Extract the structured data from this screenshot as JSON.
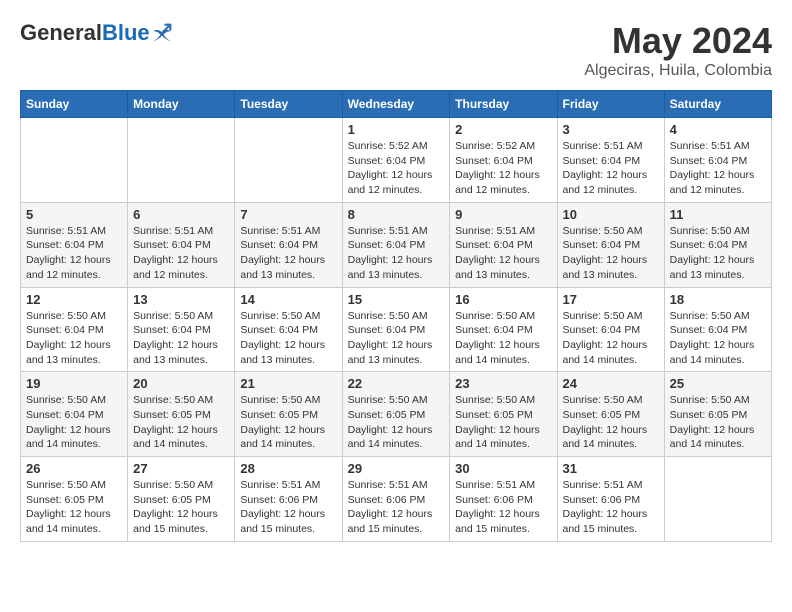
{
  "logo": {
    "general": "General",
    "blue": "Blue"
  },
  "title": {
    "month_year": "May 2024",
    "location": "Algeciras, Huila, Colombia"
  },
  "weekdays": [
    "Sunday",
    "Monday",
    "Tuesday",
    "Wednesday",
    "Thursday",
    "Friday",
    "Saturday"
  ],
  "weeks": [
    [
      {
        "day": "",
        "info": ""
      },
      {
        "day": "",
        "info": ""
      },
      {
        "day": "",
        "info": ""
      },
      {
        "day": "1",
        "info": "Sunrise: 5:52 AM\nSunset: 6:04 PM\nDaylight: 12 hours and 12 minutes."
      },
      {
        "day": "2",
        "info": "Sunrise: 5:52 AM\nSunset: 6:04 PM\nDaylight: 12 hours and 12 minutes."
      },
      {
        "day": "3",
        "info": "Sunrise: 5:51 AM\nSunset: 6:04 PM\nDaylight: 12 hours and 12 minutes."
      },
      {
        "day": "4",
        "info": "Sunrise: 5:51 AM\nSunset: 6:04 PM\nDaylight: 12 hours and 12 minutes."
      }
    ],
    [
      {
        "day": "5",
        "info": "Sunrise: 5:51 AM\nSunset: 6:04 PM\nDaylight: 12 hours and 12 minutes."
      },
      {
        "day": "6",
        "info": "Sunrise: 5:51 AM\nSunset: 6:04 PM\nDaylight: 12 hours and 12 minutes."
      },
      {
        "day": "7",
        "info": "Sunrise: 5:51 AM\nSunset: 6:04 PM\nDaylight: 12 hours and 13 minutes."
      },
      {
        "day": "8",
        "info": "Sunrise: 5:51 AM\nSunset: 6:04 PM\nDaylight: 12 hours and 13 minutes."
      },
      {
        "day": "9",
        "info": "Sunrise: 5:51 AM\nSunset: 6:04 PM\nDaylight: 12 hours and 13 minutes."
      },
      {
        "day": "10",
        "info": "Sunrise: 5:50 AM\nSunset: 6:04 PM\nDaylight: 12 hours and 13 minutes."
      },
      {
        "day": "11",
        "info": "Sunrise: 5:50 AM\nSunset: 6:04 PM\nDaylight: 12 hours and 13 minutes."
      }
    ],
    [
      {
        "day": "12",
        "info": "Sunrise: 5:50 AM\nSunset: 6:04 PM\nDaylight: 12 hours and 13 minutes."
      },
      {
        "day": "13",
        "info": "Sunrise: 5:50 AM\nSunset: 6:04 PM\nDaylight: 12 hours and 13 minutes."
      },
      {
        "day": "14",
        "info": "Sunrise: 5:50 AM\nSunset: 6:04 PM\nDaylight: 12 hours and 13 minutes."
      },
      {
        "day": "15",
        "info": "Sunrise: 5:50 AM\nSunset: 6:04 PM\nDaylight: 12 hours and 13 minutes."
      },
      {
        "day": "16",
        "info": "Sunrise: 5:50 AM\nSunset: 6:04 PM\nDaylight: 12 hours and 14 minutes."
      },
      {
        "day": "17",
        "info": "Sunrise: 5:50 AM\nSunset: 6:04 PM\nDaylight: 12 hours and 14 minutes."
      },
      {
        "day": "18",
        "info": "Sunrise: 5:50 AM\nSunset: 6:04 PM\nDaylight: 12 hours and 14 minutes."
      }
    ],
    [
      {
        "day": "19",
        "info": "Sunrise: 5:50 AM\nSunset: 6:04 PM\nDaylight: 12 hours and 14 minutes."
      },
      {
        "day": "20",
        "info": "Sunrise: 5:50 AM\nSunset: 6:05 PM\nDaylight: 12 hours and 14 minutes."
      },
      {
        "day": "21",
        "info": "Sunrise: 5:50 AM\nSunset: 6:05 PM\nDaylight: 12 hours and 14 minutes."
      },
      {
        "day": "22",
        "info": "Sunrise: 5:50 AM\nSunset: 6:05 PM\nDaylight: 12 hours and 14 minutes."
      },
      {
        "day": "23",
        "info": "Sunrise: 5:50 AM\nSunset: 6:05 PM\nDaylight: 12 hours and 14 minutes."
      },
      {
        "day": "24",
        "info": "Sunrise: 5:50 AM\nSunset: 6:05 PM\nDaylight: 12 hours and 14 minutes."
      },
      {
        "day": "25",
        "info": "Sunrise: 5:50 AM\nSunset: 6:05 PM\nDaylight: 12 hours and 14 minutes."
      }
    ],
    [
      {
        "day": "26",
        "info": "Sunrise: 5:50 AM\nSunset: 6:05 PM\nDaylight: 12 hours and 14 minutes."
      },
      {
        "day": "27",
        "info": "Sunrise: 5:50 AM\nSunset: 6:05 PM\nDaylight: 12 hours and 15 minutes."
      },
      {
        "day": "28",
        "info": "Sunrise: 5:51 AM\nSunset: 6:06 PM\nDaylight: 12 hours and 15 minutes."
      },
      {
        "day": "29",
        "info": "Sunrise: 5:51 AM\nSunset: 6:06 PM\nDaylight: 12 hours and 15 minutes."
      },
      {
        "day": "30",
        "info": "Sunrise: 5:51 AM\nSunset: 6:06 PM\nDaylight: 12 hours and 15 minutes."
      },
      {
        "day": "31",
        "info": "Sunrise: 5:51 AM\nSunset: 6:06 PM\nDaylight: 12 hours and 15 minutes."
      },
      {
        "day": "",
        "info": ""
      }
    ]
  ]
}
